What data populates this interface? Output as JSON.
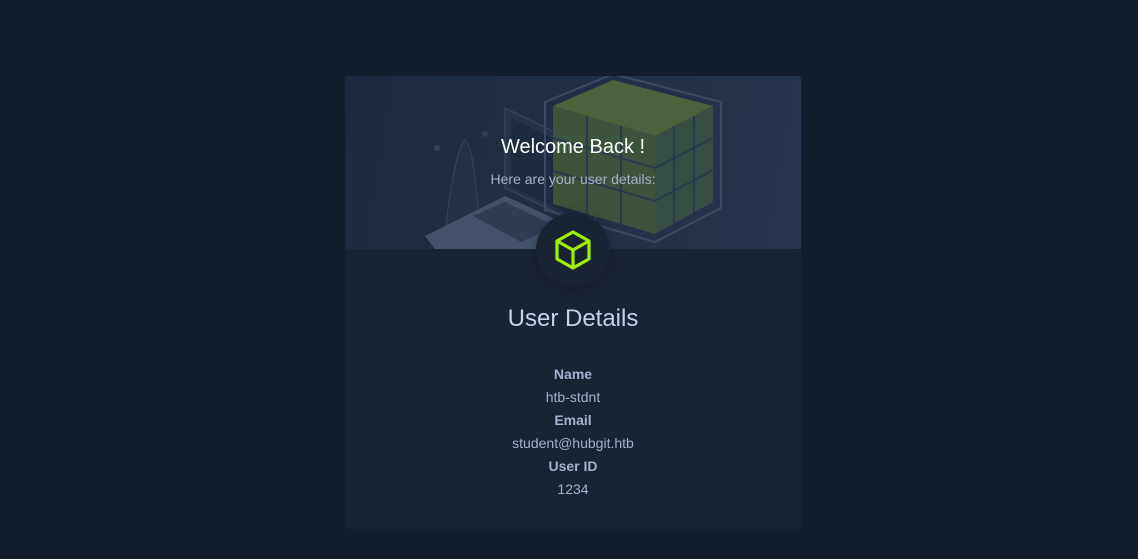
{
  "banner": {
    "title": "Welcome Back !",
    "subtitle": "Here are your user details:"
  },
  "avatar": {
    "icon": "cube-icon",
    "icon_color": "#9fef00"
  },
  "details": {
    "title": "User Details",
    "fields": [
      {
        "label": "Name",
        "value": "htb-stdnt"
      },
      {
        "label": "Email",
        "value": "student@hubgit.htb"
      },
      {
        "label": "User ID",
        "value": "1234"
      }
    ]
  },
  "colors": {
    "background": "#141d2b",
    "card": "#1a2332",
    "accent": "#9fef00",
    "text_muted": "#a4b1cd"
  }
}
